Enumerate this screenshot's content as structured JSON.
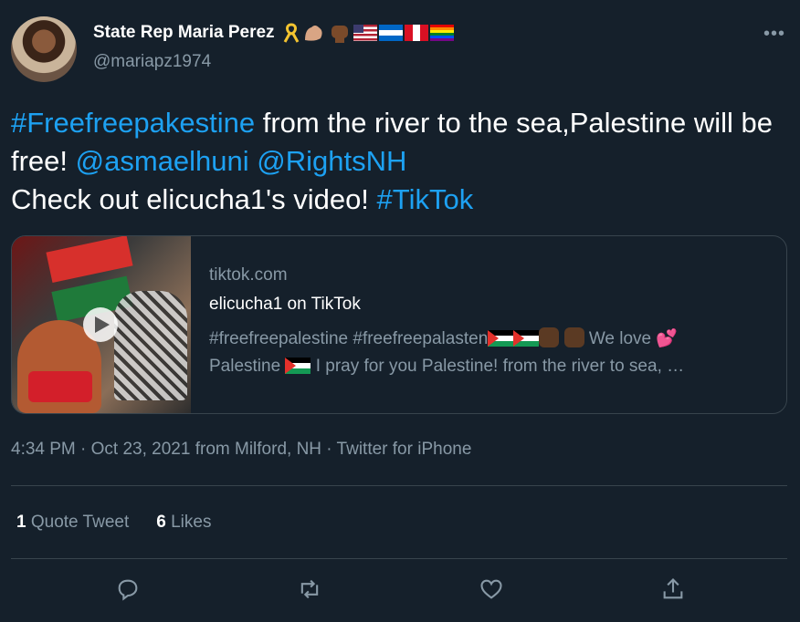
{
  "author": {
    "name": "State Rep Maria Perez",
    "handle": "@mariapz1974",
    "name_emojis": [
      "ribbon-emoji",
      "flexed-biceps-emoji",
      "raised-fist-emoji",
      "us-flag",
      "nicaragua-flag",
      "peru-flag",
      "rainbow-flag"
    ]
  },
  "tweet": {
    "hashtag1": "#Freefreepakestine",
    "text1": " from the river to the sea,Palestine will be free! ",
    "mention1": "@asmaelhuni",
    "space": " ",
    "mention2": "@RightsNH",
    "text2": "Check out elicucha1's video! ",
    "hashtag2": "#TikTok"
  },
  "card": {
    "domain": "tiktok.com",
    "title": "elicucha1 on TikTok",
    "desc_part1": "#freefreepalestine #freefreepalasten",
    "desc_part2": " We love ",
    "desc_part3": "Palestine ",
    "desc_part4": " I pray for you Palestine! from the river to sea, …"
  },
  "meta": {
    "timestamp": "4:34 PM · Oct 23, 2021 from Milford, NH · Twitter for iPhone"
  },
  "stats": {
    "quote_count": "1",
    "quote_label": " Quote Tweet",
    "like_count": "6",
    "like_label": " Likes"
  },
  "colors": {
    "background": "#15202b",
    "link": "#1da1f2",
    "secondary_text": "#8899a6",
    "border": "#38444d"
  }
}
